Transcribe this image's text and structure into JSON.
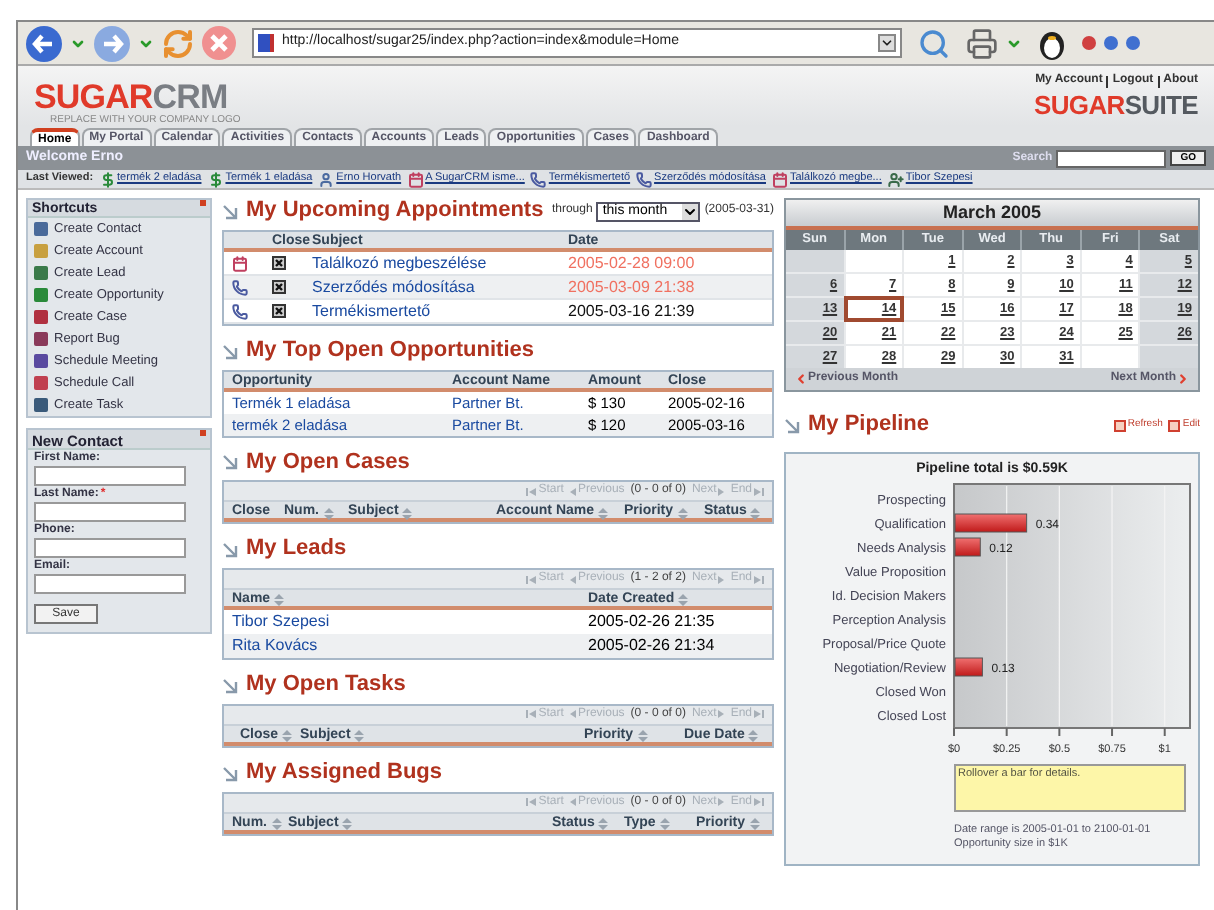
{
  "browser": {
    "url": "http://localhost/sugar25/index.php?action=index&module=Home"
  },
  "header": {
    "logo": [
      "SUGAR",
      "CRM"
    ],
    "tagline": "REPLACE WITH YOUR COMPANY LOGO",
    "links": [
      "My Account",
      "Logout",
      "About"
    ],
    "brand": [
      "SUGAR",
      "SUITE"
    ]
  },
  "tabs": [
    {
      "label": "Home",
      "selected": true
    },
    {
      "label": "My Portal",
      "selected": false
    },
    {
      "label": "Calendar",
      "selected": false
    },
    {
      "label": "Activities",
      "selected": false
    },
    {
      "label": "Contacts",
      "selected": false
    },
    {
      "label": "Accounts",
      "selected": false
    },
    {
      "label": "Leads",
      "selected": false
    },
    {
      "label": "Opportunities",
      "selected": false
    },
    {
      "label": "Cases",
      "selected": false
    },
    {
      "label": "Dashboard",
      "selected": false
    }
  ],
  "welcome": "Welcome Erno",
  "search": {
    "label": "Search",
    "button": "GO"
  },
  "last_viewed": {
    "label": "Last Viewed:",
    "items": [
      {
        "kind": "opportunity",
        "label": "termék 2 eladása"
      },
      {
        "kind": "opportunity",
        "label": "Termék 1 eladása"
      },
      {
        "kind": "contact",
        "label": "Erno Horvath"
      },
      {
        "kind": "meeting",
        "label": "A SugarCRM isme..."
      },
      {
        "kind": "call",
        "label": "Termékismertető"
      },
      {
        "kind": "call",
        "label": "Szerződés módosítása"
      },
      {
        "kind": "meeting",
        "label": "Találkozó megbe..."
      },
      {
        "kind": "lead",
        "label": "Tibor Szepesi"
      }
    ]
  },
  "shortcuts": {
    "title": "Shortcuts",
    "items": [
      {
        "label": "Create Contact",
        "color": "#4a6a9a"
      },
      {
        "label": "Create Account",
        "color": "#c8a040"
      },
      {
        "label": "Create Lead",
        "color": "#3a7a4a"
      },
      {
        "label": "Create Opportunity",
        "color": "#2a8a3a"
      },
      {
        "label": "Create Case",
        "color": "#b03040"
      },
      {
        "label": "Report Bug",
        "color": "#8a3a5a"
      },
      {
        "label": "Schedule Meeting",
        "color": "#5a4aa0"
      },
      {
        "label": "Schedule Call",
        "color": "#c04050"
      },
      {
        "label": "Create Task",
        "color": "#3a5a7a"
      }
    ]
  },
  "new_contact": {
    "title": "New Contact",
    "fields": [
      {
        "label": "First Name:"
      },
      {
        "label": "Last Name:",
        "mark": "*"
      },
      {
        "label": "Phone:"
      },
      {
        "label": "Email:"
      }
    ],
    "button": "Save"
  },
  "appointments": {
    "title": "My Upcoming Appointments",
    "through": "through",
    "range": "this month",
    "end_date": "(2005-03-31)",
    "columns": [
      "Close",
      "Subject",
      "Date"
    ],
    "rows": [
      {
        "kind": "meeting",
        "subject": "Találkozó megbeszélése",
        "date": "2005-02-28 09:00",
        "overdue": true
      },
      {
        "kind": "call",
        "subject": "Szerződés módosítása",
        "date": "2005-03-09 21:38",
        "overdue": true
      },
      {
        "kind": "call",
        "subject": "Termékismertető",
        "date": "2005-03-16 21:39",
        "overdue": false
      }
    ]
  },
  "opportunities": {
    "title": "My Top Open Opportunities",
    "columns": [
      "Opportunity",
      "Account Name",
      "Amount",
      "Close"
    ],
    "rows": [
      [
        "Termék 1 eladása",
        "Partner Bt.",
        "$ 130",
        "2005-02-16"
      ],
      [
        "termék 2 eladása",
        "Partner Bt.",
        "$ 120",
        "2005-03-16"
      ]
    ]
  },
  "open_cases": {
    "title": "My Open Cases",
    "pager": {
      "start": "Start",
      "previous": "Previous",
      "range": "(0 - 0 of 0)",
      "next": "Next",
      "end": "End"
    },
    "columns": [
      {
        "label": "Close",
        "sortable": false
      },
      {
        "label": "Num.",
        "sortable": true
      },
      {
        "label": "Subject",
        "sortable": true
      },
      {
        "label": "Account Name",
        "sortable": true
      },
      {
        "label": "Priority",
        "sortable": true
      },
      {
        "label": "Status",
        "sortable": true
      }
    ]
  },
  "leads": {
    "title": "My Leads",
    "pager": {
      "start": "Start",
      "previous": "Previous",
      "range": "(1 - 2 of 2)",
      "next": "Next",
      "end": "End"
    },
    "columns": [
      {
        "label": "Name",
        "sortable": true
      },
      {
        "label": "Date Created",
        "sortable": true
      }
    ],
    "rows": [
      [
        "Tibor Szepesi",
        "2005-02-26 21:35"
      ],
      [
        "Rita Kovács",
        "2005-02-26 21:34"
      ]
    ]
  },
  "tasks": {
    "title": "My Open Tasks",
    "pager": {
      "start": "Start",
      "previous": "Previous",
      "range": "(0 - 0 of 0)",
      "next": "Next",
      "end": "End"
    },
    "columns": [
      {
        "label": "Close",
        "sortable": true
      },
      {
        "label": "Subject",
        "sortable": true
      },
      {
        "label": "Priority",
        "sortable": true
      },
      {
        "label": "Due Date",
        "sortable": true
      }
    ]
  },
  "bugs": {
    "title": "My Assigned Bugs",
    "pager": {
      "start": "Start",
      "previous": "Previous",
      "range": "(0 - 0 of 0)",
      "next": "Next",
      "end": "End"
    },
    "columns": [
      {
        "label": "Num.",
        "sortable": true
      },
      {
        "label": "Subject",
        "sortable": true
      },
      {
        "label": "Status",
        "sortable": true
      },
      {
        "label": "Type",
        "sortable": true
      },
      {
        "label": "Priority",
        "sortable": true
      }
    ]
  },
  "calendar": {
    "title": "March 2005",
    "weekdays": [
      "Sun",
      "Mon",
      "Tue",
      "Wed",
      "Thu",
      "Fri",
      "Sat"
    ],
    "weeks": [
      [
        {
          "label": "1",
          "selected": false
        },
        {
          "label": "2",
          "selected": false
        },
        {
          "label": "3",
          "selected": false
        },
        {
          "label": "4",
          "selected": false
        },
        {
          "label": "5",
          "selected": false
        }
      ],
      [
        {
          "label": "6",
          "selected": false
        },
        {
          "label": "7",
          "selected": false
        },
        {
          "label": "8",
          "selected": false
        },
        {
          "label": "9",
          "selected": false
        },
        {
          "label": "10",
          "selected": false
        },
        {
          "label": "11",
          "selected": false
        },
        {
          "label": "12",
          "selected": false
        }
      ],
      [
        {
          "label": "13",
          "selected": false
        },
        {
          "label": "14",
          "selected": true
        },
        {
          "label": "15",
          "selected": false
        },
        {
          "label": "16",
          "selected": false
        },
        {
          "label": "17",
          "selected": false
        },
        {
          "label": "18",
          "selected": false
        },
        {
          "label": "19",
          "selected": false
        }
      ],
      [
        {
          "label": "20",
          "selected": false
        },
        {
          "label": "21",
          "selected": false
        },
        {
          "label": "22",
          "selected": false
        },
        {
          "label": "23",
          "selected": false
        },
        {
          "label": "24",
          "selected": false
        },
        {
          "label": "25",
          "selected": false
        },
        {
          "label": "26",
          "selected": false
        }
      ],
      [
        {
          "label": "27",
          "selected": false
        },
        {
          "label": "28",
          "selected": false
        },
        {
          "label": "29",
          "selected": false
        },
        {
          "label": "30",
          "selected": false
        },
        {
          "label": "31",
          "selected": false
        }
      ]
    ],
    "previous": "Previous Month",
    "next": "Next Month"
  },
  "pipeline": {
    "title": "My Pipeline",
    "actions": [
      "Refresh",
      "Edit"
    ],
    "chart_data": {
      "type": "bar",
      "orientation": "horizontal",
      "title": "Pipeline total is $0.59K",
      "categories": [
        "Prospecting",
        "Qualification",
        "Needs Analysis",
        "Value Proposition",
        "Id. Decision Makers",
        "Perception Analysis",
        "Proposal/Price Quote",
        "Negotiation/Review",
        "Closed Won",
        "Closed Lost"
      ],
      "values": [
        0,
        0.34,
        0.12,
        0,
        0,
        0,
        0,
        0.13,
        0,
        0
      ],
      "value_labels": [
        null,
        "0.34",
        "0.12",
        null,
        null,
        null,
        null,
        "0.13",
        null,
        null
      ],
      "grid": true,
      "xlim": [
        0,
        1.12
      ],
      "xticks": [
        {
          "value": 0,
          "label": "$0"
        },
        {
          "value": 0.25,
          "label": "$0.25"
        },
        {
          "value": 0.5,
          "label": "$0.5"
        },
        {
          "value": 0.75,
          "label": "$0.75"
        },
        {
          "value": 1,
          "label": "$1"
        }
      ]
    },
    "hint": "Rollover a bar for details.",
    "footnotes": [
      "Date range is 2005-01-01 to 2100-01-01",
      "Opportunity size in $1K"
    ]
  }
}
